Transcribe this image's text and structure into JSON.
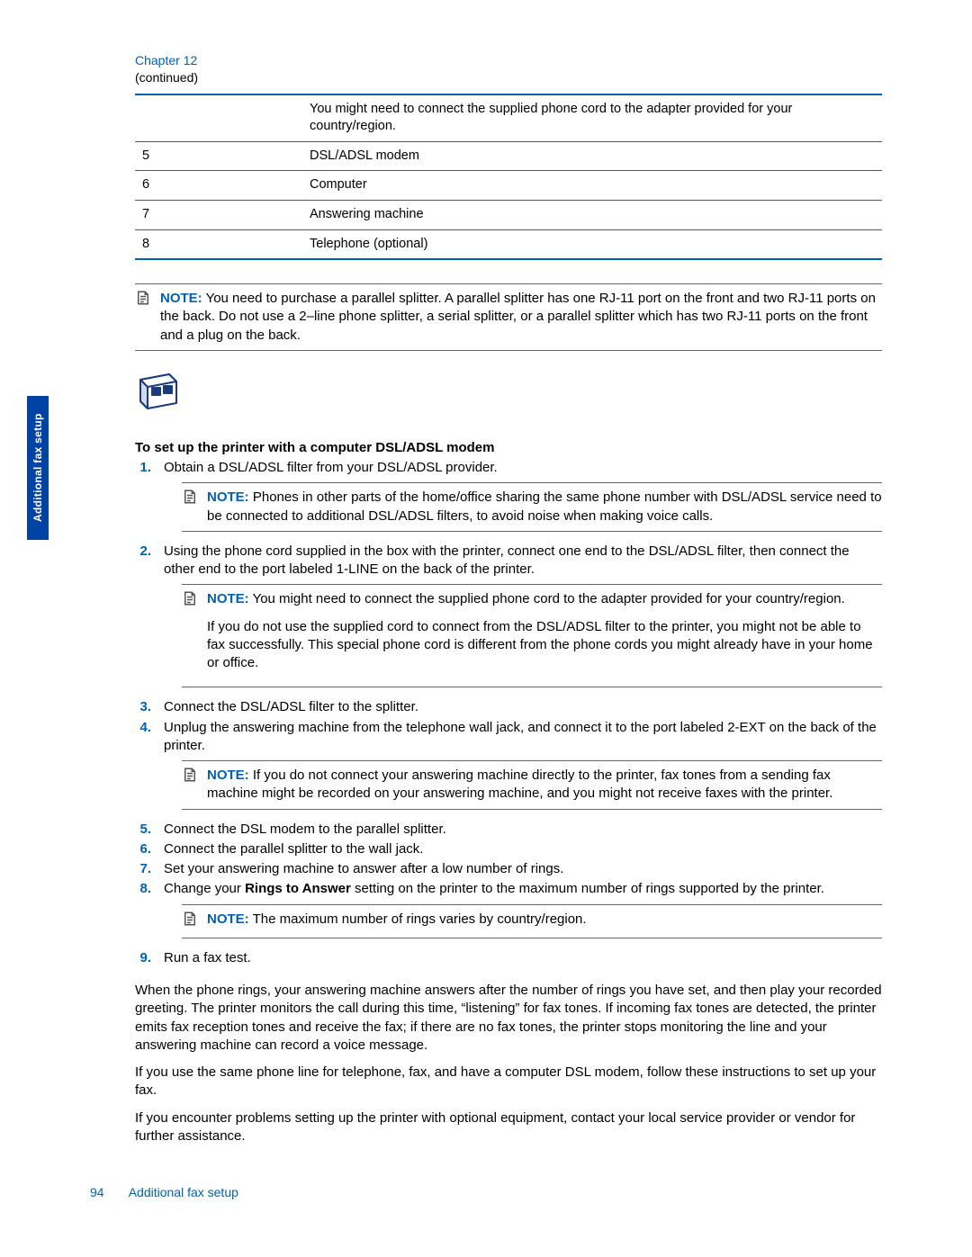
{
  "header": {
    "chapter": "Chapter 12",
    "continued": "(continued)"
  },
  "table": {
    "rows": [
      {
        "n": "",
        "d": "You might need to connect the supplied phone cord to the adapter provided for your country/region."
      },
      {
        "n": "5",
        "d": "DSL/ADSL modem"
      },
      {
        "n": "6",
        "d": "Computer"
      },
      {
        "n": "7",
        "d": "Answering machine"
      },
      {
        "n": "8",
        "d": "Telephone (optional)"
      }
    ]
  },
  "note_top": {
    "label": "NOTE:",
    "text": "You need to purchase a parallel splitter. A parallel splitter has one RJ-11 port on the front and two RJ-11 ports on the back. Do not use a 2–line phone splitter, a serial splitter, or a parallel splitter which has two RJ-11 ports on the front and a plug on the back."
  },
  "section_title": "To set up the printer with a computer DSL/ADSL modem",
  "steps": {
    "s1": {
      "n": "1.",
      "t": "Obtain a DSL/ADSL filter from your DSL/ADSL provider."
    },
    "s1_note": {
      "label": "NOTE:",
      "text": "Phones in other parts of the home/office sharing the same phone number with DSL/ADSL service need to be connected to additional DSL/ADSL filters, to avoid noise when making voice calls."
    },
    "s2": {
      "n": "2.",
      "t": "Using the phone cord supplied in the box with the printer, connect one end to the DSL/ADSL filter, then connect the other end to the port labeled 1-LINE on the back of the printer."
    },
    "s2_note": {
      "label": "NOTE:",
      "text": "You might need to connect the supplied phone cord to the adapter provided for your country/region."
    },
    "s2_note_p2": "If you do not use the supplied cord to connect from the DSL/ADSL filter to the printer, you might not be able to fax successfully. This special phone cord is different from the phone cords you might already have in your home or office.",
    "s3": {
      "n": "3.",
      "t": "Connect the DSL/ADSL filter to the splitter."
    },
    "s4": {
      "n": "4.",
      "t": "Unplug the answering machine from the telephone wall jack, and connect it to the port labeled 2-EXT on the back of the printer."
    },
    "s4_note": {
      "label": "NOTE:",
      "text": "If you do not connect your answering machine directly to the printer, fax tones from a sending fax machine might be recorded on your answering machine, and you might not receive faxes with the printer."
    },
    "s5": {
      "n": "5.",
      "t": "Connect the DSL modem to the parallel splitter."
    },
    "s6": {
      "n": "6.",
      "t": "Connect the parallel splitter to the wall jack."
    },
    "s7": {
      "n": "7.",
      "t": "Set your answering machine to answer after a low number of rings."
    },
    "s8": {
      "n": "8.",
      "t_before": "Change your ",
      "t_bold": "Rings to Answer",
      "t_after": " setting on the printer to the maximum number of rings supported by the printer."
    },
    "s8_note": {
      "label": "NOTE:",
      "text": "The maximum number of rings varies by country/region."
    },
    "s9": {
      "n": "9.",
      "t": "Run a fax test."
    }
  },
  "post_para1": "When the phone rings, your answering machine answers after the number of rings you have set, and then play your recorded greeting. The printer monitors the call during this time, “listening” for fax tones. If incoming fax tones are detected, the printer emits fax reception tones and receive the fax; if there are no fax tones, the printer stops monitoring the line and your answering machine can record a voice message.",
  "post_para2": "If you use the same phone line for telephone, fax, and have a computer DSL modem, follow these instructions to set up your fax.",
  "post_para3": "If you encounter problems setting up the printer with optional equipment, contact your local service provider or vendor for further assistance.",
  "footer": {
    "page": "94",
    "title": "Additional fax setup"
  },
  "sidetab": "Additional fax setup"
}
